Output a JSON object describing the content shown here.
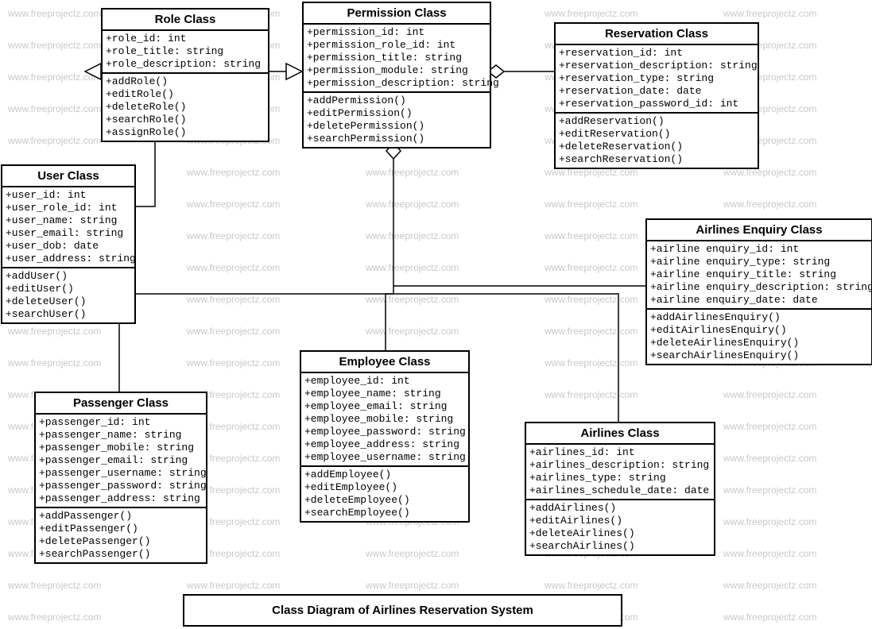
{
  "diagram_title": "Class Diagram of Airlines Reservation System",
  "watermark_text": "www.freeprojectz.com",
  "classes": {
    "role": {
      "title": "Role Class",
      "attributes": [
        "+role_id: int",
        "+role_title: string",
        "+role_description: string"
      ],
      "methods": [
        "+addRole()",
        "+editRole()",
        "+deleteRole()",
        "+searchRole()",
        "+assignRole()"
      ]
    },
    "permission": {
      "title": "Permission Class",
      "attributes": [
        "+permission_id: int",
        "+permission_role_id: int",
        "+permission_title: string",
        "+permission_module: string",
        "+permission_description: string"
      ],
      "methods": [
        "+addPermission()",
        "+editPermission()",
        "+deletePermission()",
        "+searchPermission()"
      ]
    },
    "reservation": {
      "title": "Reservation Class",
      "attributes": [
        "+reservation_id: int",
        "+reservation_description: string",
        "+reservation_type: string",
        "+reservation_date: date",
        "+reservation_password_id: int"
      ],
      "methods": [
        "+addReservation()",
        "+editReservation()",
        "+deleteReservation()",
        "+searchReservation()"
      ]
    },
    "user": {
      "title": "User Class",
      "attributes": [
        "+user_id: int",
        "+user_role_id: int",
        "+user_name: string",
        "+user_email: string",
        "+user_dob: date",
        "+user_address: string"
      ],
      "methods": [
        "+addUser()",
        "+editUser()",
        "+deleteUser()",
        "+searchUser()"
      ]
    },
    "airlines_enquiry": {
      "title": "Airlines Enquiry Class",
      "attributes": [
        "+airline enquiry_id: int",
        "+airline enquiry_type: string",
        "+airline enquiry_title: string",
        "+airline enquiry_description: string",
        "+airline enquiry_date: date"
      ],
      "methods": [
        "+addAirlinesEnquiry()",
        "+editAirlinesEnquiry()",
        "+deleteAirlinesEnquiry()",
        "+searchAirlinesEnquiry()"
      ]
    },
    "employee": {
      "title": "Employee Class",
      "attributes": [
        "+employee_id: int",
        "+employee_name: string",
        "+employee_email: string",
        "+employee_mobile: string",
        "+employee_password: string",
        "+employee_address: string",
        "+employee_username: string"
      ],
      "methods": [
        "+addEmployee()",
        "+editEmployee()",
        "+deleteEmployee()",
        "+searchEmployee()"
      ]
    },
    "passenger": {
      "title": "Passenger Class",
      "attributes": [
        "+passenger_id: int",
        "+passenger_name: string",
        "+passenger_mobile: string",
        "+passenger_email: string",
        "+passenger_username: string",
        "+passenger_password: string",
        "+passenger_address: string"
      ],
      "methods": [
        "+addPassenger()",
        "+editPassenger()",
        "+deletePassenger()",
        "+searchPassenger()"
      ]
    },
    "airlines": {
      "title": "Airlines Class",
      "attributes": [
        "+airlines_id: int",
        "+airlines_description: string",
        "+airlines_type: string",
        "+airlines_schedule_date: date"
      ],
      "methods": [
        "+addAirlines()",
        "+editAirlines()",
        "+deleteAirlines()",
        "+searchAirlines()"
      ]
    }
  }
}
